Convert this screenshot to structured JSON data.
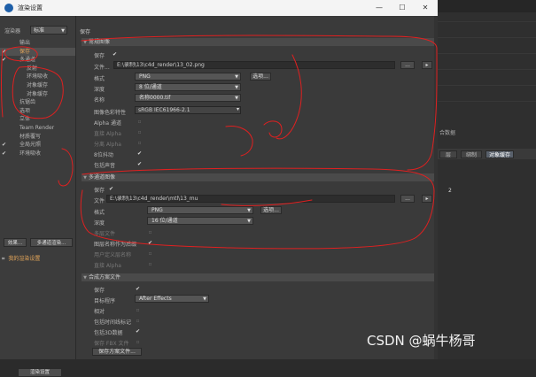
{
  "window": {
    "title": "渲染设置"
  },
  "sidebar": {
    "renderer_label": "渲染器",
    "renderer_value": "标准",
    "items": [
      {
        "label": "输出",
        "checked": false,
        "indent": 0
      },
      {
        "label": "保存",
        "checked": true,
        "indent": 0,
        "selected": true
      },
      {
        "label": "多通道",
        "checked": true,
        "indent": 0
      },
      {
        "label": "反射",
        "checked": false,
        "indent": 1
      },
      {
        "label": "环境吸收",
        "checked": false,
        "indent": 1
      },
      {
        "label": "对象缓存",
        "checked": false,
        "indent": 1
      },
      {
        "label": "对象缓存",
        "checked": false,
        "indent": 1
      },
      {
        "label": "抗锯齿",
        "checked": false,
        "indent": 0
      },
      {
        "label": "选项",
        "checked": false,
        "indent": 0
      },
      {
        "label": "立体",
        "checked": false,
        "indent": 0
      },
      {
        "label": "Team Render",
        "checked": false,
        "indent": 0
      },
      {
        "label": "材质覆写",
        "checked": false,
        "indent": 0
      },
      {
        "label": "全局光照",
        "checked": true,
        "indent": 0
      },
      {
        "label": "环境吸收",
        "checked": true,
        "indent": 0
      }
    ],
    "effects_button": "效果...",
    "multipass_button": "多通道渲染...",
    "preset_name": "我的渲染设置",
    "render_settings_button": "渲染设置"
  },
  "main": {
    "title": "保存",
    "regular_image": {
      "header": "常规图像",
      "save_label": "保存",
      "save_checked": true,
      "file_label": "文件...",
      "file_value": "E:\\录制\\13\\c4d_render\\13_02.png",
      "ellipsis_button": "...",
      "format_label": "格式",
      "format_value": "PNG",
      "options_button": "选项...",
      "depth_label": "深度",
      "depth_value": "8 位/通道",
      "name_label": "名称",
      "name_value": "名称0000.tif",
      "colorprofile_label": "图像色彩特性",
      "colorprofile_value": "sRGB IEC61966-2.1",
      "alpha_label": "Alpha 通道",
      "alpha_checked": false,
      "straight_alpha_label": "直接 Alpha",
      "straight_alpha_checked": false,
      "separate_alpha_label": "分离 Alpha",
      "separate_alpha_checked": false,
      "dither_label": "8位抖动",
      "dither_checked": true,
      "include_sound_label": "包括声音",
      "include_sound_checked": true
    },
    "multipass_image": {
      "header": "多通道图像",
      "save_label": "保存",
      "save_checked": true,
      "file_label": "文件",
      "file_value": "E:\\录制\\13\\c4d_render\\mtl\\13_mu",
      "ellipsis_button": "...",
      "format_label": "格式",
      "format_value": "PNG",
      "options_button": "选项...",
      "depth_label": "深度",
      "depth_value": "16 位/通道",
      "multilayer_label": "多层文件",
      "multilayer_checked": false,
      "layername_label": "图层名称作为后缀",
      "layername_checked": true,
      "userdefined_label": "用户定义层名称",
      "userdefined_checked": false,
      "straight_alpha_label": "直接 Alpha",
      "straight_alpha_checked": false
    },
    "compositing": {
      "header": "合成方案文件",
      "save_label": "保存",
      "save_checked": true,
      "target_label": "目标程序",
      "target_value": "After Effects",
      "relative_label": "相对",
      "relative_checked": false,
      "include_timeline_label": "包括时间线标记",
      "include_timeline_checked": false,
      "include_3d_label": "包括3D数据",
      "include_3d_checked": true,
      "save_fbx_label": "保存 FBX 文件",
      "save_fbx_checked": false,
      "save_button": "保存方案文件..."
    }
  },
  "right_panel": {
    "label_top": "合数据",
    "tabs": [
      "层",
      "绑制",
      "对象缓存"
    ],
    "value": "2"
  },
  "watermark": "CSDN @蜗牛杨哥",
  "colors": {
    "annotation_red": "#e02020",
    "selected_text": "#e8a85a"
  }
}
